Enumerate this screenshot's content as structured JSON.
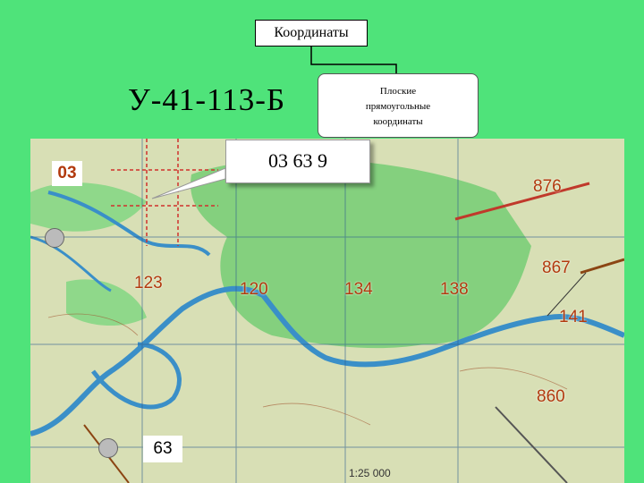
{
  "header": {
    "title": "Координаты",
    "sheet_id": "У-41-113-Б",
    "plane_label_line1": "Плоские",
    "plane_label_line2": "прямоугольные",
    "plane_label_line3": "координаты"
  },
  "callout": {
    "value": "03 63 9"
  },
  "map": {
    "labels": {
      "l03": "03",
      "l876": "876",
      "l867": "867",
      "l123": "123",
      "l120": "120",
      "l134": "134",
      "l138": "138",
      "l141": "141",
      "l860": "860",
      "l63": "63"
    },
    "scale_text": "1:25 000"
  },
  "colors": {
    "background": "#4fe37a",
    "label": "#b23a0e",
    "forest": "#7fcf7a",
    "water": "#3a8fc8"
  }
}
